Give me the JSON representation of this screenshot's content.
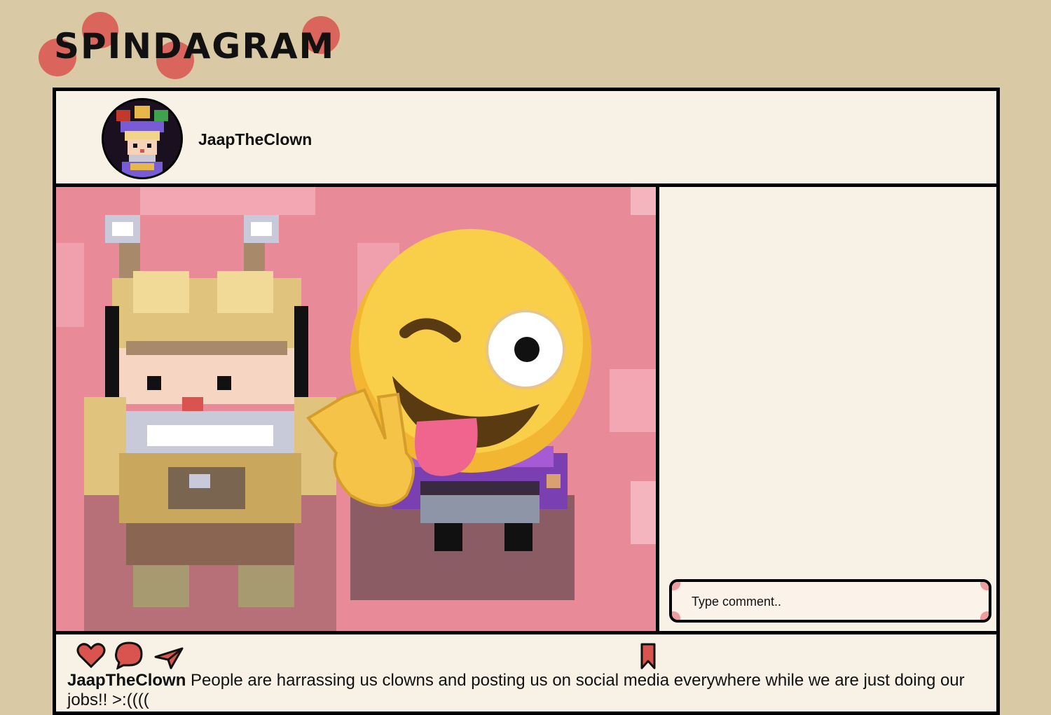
{
  "app": {
    "name": "SPINDAGRAM",
    "brand_color": "#d9534f",
    "background_color": "#d9c9a5",
    "panel_color": "#f8f2e6"
  },
  "post": {
    "username": "JaapTheClown",
    "caption_user": "JaapTheClown",
    "caption_text": "People are harrassing us clowns and posting us on social media everywhere while we are just doing our jobs!! >:((((",
    "image_alt": "pixel-art clown character and another character with a winking tongue-out emoji and peace-sign hand"
  },
  "comments": {
    "input_placeholder": "Type comment.."
  },
  "icons": {
    "like": "heart-icon",
    "comment": "speech-bubble-icon",
    "share": "paper-plane-icon",
    "save": "bookmark-icon"
  }
}
